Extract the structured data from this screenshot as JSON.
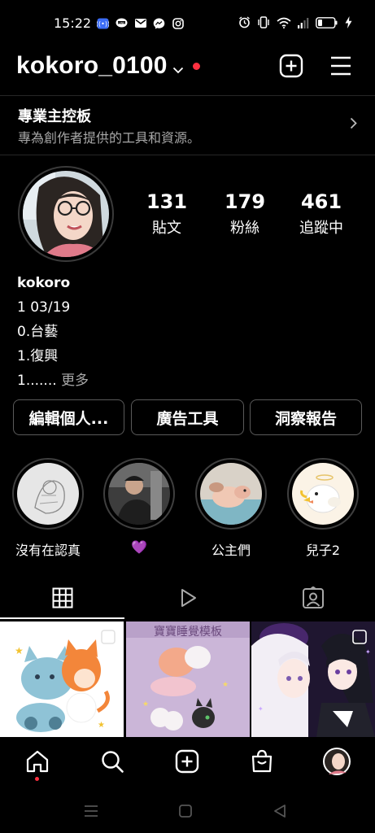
{
  "status_bar": {
    "time": "15:22",
    "left_icons": [
      "nfc-icon",
      "line-icon",
      "mail-icon",
      "messenger-icon",
      "instagram-icon"
    ],
    "right_icons": [
      "alarm-icon",
      "vibrate-icon",
      "wifi-icon",
      "signal-icon",
      "battery-icon",
      "charging-icon"
    ]
  },
  "header": {
    "username": "kokoro_0100",
    "add_icon": "plus-square-icon",
    "menu_icon": "hamburger-menu-icon"
  },
  "dashboard": {
    "title": "專業主控板",
    "subtitle": "專為創作者提供的工具和資源。"
  },
  "stats": [
    {
      "value": "131",
      "label": "貼文"
    },
    {
      "value": "179",
      "label": "粉絲"
    },
    {
      "value": "461",
      "label": "追蹤中"
    }
  ],
  "bio": {
    "name": "kokoro",
    "line1": "1 03/19",
    "line2": "0.台藝",
    "line3": "1.復興",
    "line4": "1.......",
    "more": "更多"
  },
  "buttons": {
    "edit": "編輯個人...",
    "ads": "廣告工具",
    "insights": "洞察報告"
  },
  "highlights": [
    {
      "label": "沒有在認真"
    },
    {
      "label": "💜"
    },
    {
      "label": "公主們"
    },
    {
      "label": "兒子2"
    }
  ],
  "tabs": [
    "grid-icon",
    "reels-icon",
    "tagged-icon"
  ],
  "grid": {
    "post2_title": "寶寶睡覺模板"
  },
  "bottom_nav": [
    "home-icon",
    "search-icon",
    "create-icon",
    "shop-icon",
    "profile-avatar"
  ],
  "colors": {
    "background": "#000000",
    "notification": "#ff3040",
    "muted_text": "#a8a8a8",
    "border": "#5a5a5a"
  }
}
